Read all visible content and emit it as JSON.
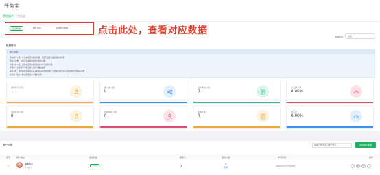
{
  "header": {
    "title": "任务宝"
  },
  "breadcrumb": {
    "root": "营销插件",
    "sep": "/",
    "current": "任务宝"
  },
  "tabs": {
    "items": [
      {
        "label": "任务数据"
      },
      {
        "label": "推广渠道"
      },
      {
        "label": "活动参与数据"
      }
    ],
    "hint": "点击此处，查看对应数据"
  },
  "filter": {
    "label": "数据筛选",
    "value": "全部"
  },
  "stats": {
    "title": "数据概况",
    "notice_title": "统计说明",
    "notice_lines": [
      "活动参与人数：参与本次活动的用户数，包括已完成及未完成的用户数",
      "助力总人数：为参与活动的用户助力的总人数",
      "新增关注人数：通过本次活动新增关注公众号的用户数",
      "转化率：完成任务人数占参与活动人数的比例",
      "取关人数：通过本次活动关注后又取消关注的用户数，包括助力者与参与者在内的全部取关人数",
      "取关率：取关人数占新增关注人数的比例"
    ]
  },
  "cards": [
    {
      "label": "活动参与人数",
      "value": "1",
      "icon": "user-hand-icon",
      "color": "#f0a63d",
      "tint": "#fdf1e1"
    },
    {
      "label": "助力总人数",
      "value": "0",
      "icon": "share-icon",
      "color": "#3d8ff0",
      "tint": "#e4effd"
    },
    {
      "label": "新增关注人数",
      "value": "0",
      "icon": "document-icon",
      "color": "#2fb89a",
      "tint": "#dff4ee"
    },
    {
      "label": "关注转化率",
      "value": "0.00%",
      "icon": "gauge-icon",
      "color": "#e84b6a",
      "tint": "#fbe2e7"
    },
    {
      "label": "完成任务人数",
      "value": "0",
      "icon": "user-hand-icon",
      "color": "#f0a63d",
      "tint": "#fdf1e1"
    },
    {
      "label": "领取奖励人数",
      "value": "0",
      "icon": "user-icon",
      "color": "#e84b6a",
      "tint": "#fbe2e7"
    },
    {
      "label": "取关人数",
      "value": "0",
      "icon": "document-icon",
      "color": "#f0a63d",
      "tint": "#fdf1e1"
    },
    {
      "label": "取关率",
      "value": "0.00%",
      "icon": "gauge-icon",
      "color": "#3d8ff0",
      "tint": "#e4effd"
    }
  ],
  "list": {
    "title": "用户列表",
    "search_placeholder": "请输入用户昵称/手机号搜索",
    "export_label": "导出用户数据",
    "columns": [
      "序号",
      "用户信息",
      "任务状态",
      "推荐人",
      "邀请人数",
      "参与时间",
      "操作"
    ],
    "rows": [
      {
        "index": "1",
        "nickname": "温柔的平",
        "subtext": "粉丝编号",
        "status": "进行中",
        "referrer": "无",
        "invite_count": "0",
        "invite_link": "查看",
        "time": "2023-09-07 17:03:59"
      }
    ]
  }
}
